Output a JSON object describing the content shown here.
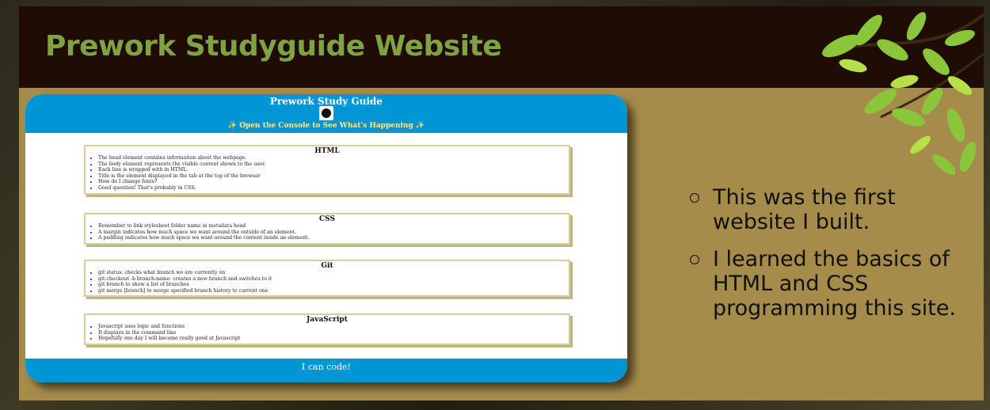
{
  "slide": {
    "title": "Prework Studyguide Website",
    "colors": {
      "title_bar": "#1f0d05",
      "title_text": "#7fa243",
      "slide_bg": "#a68c4b"
    },
    "bullets": [
      "This was the first website I built.",
      "I learned the basics of HTML and CSS programming this site."
    ]
  },
  "website": {
    "header": {
      "title": "Prework Study Guide",
      "subtitle": "✨ Open the Console to See What's Happening ✨",
      "icon": "cat-icon",
      "color": "#0096d6"
    },
    "cards": [
      {
        "heading": "HTML",
        "items": [
          "The head element contains information about the webpage.",
          "The body element represents the visible content shown to the user.",
          "Each line is wrapped with in HTML.",
          "Title is the element displayed in the tab at the top of the browser",
          "How do I change fonts?",
          "Good question! That's probably in CSS."
        ]
      },
      {
        "heading": "CSS",
        "items": [
          "Remember to link stylesheet folder name in metadata head",
          "A margin indicates how much space we want around the outside of an element.",
          "A padding indicates how much space we want around the content inside an element."
        ]
      },
      {
        "heading": "Git",
        "items": [
          "git status: checks what branch we are currently on",
          "git checkout -b branch-name: creates a new branch and switches to it",
          "git branch to show a list of branches",
          "git merge [branch] to merge specified branch history to current one"
        ]
      },
      {
        "heading": "JavaScript",
        "items": [
          "Javascript uses logic and functions",
          "It displays in the command line",
          "Hopefully one day I will become really good at Javascript"
        ]
      }
    ],
    "footer": "I can code!"
  }
}
